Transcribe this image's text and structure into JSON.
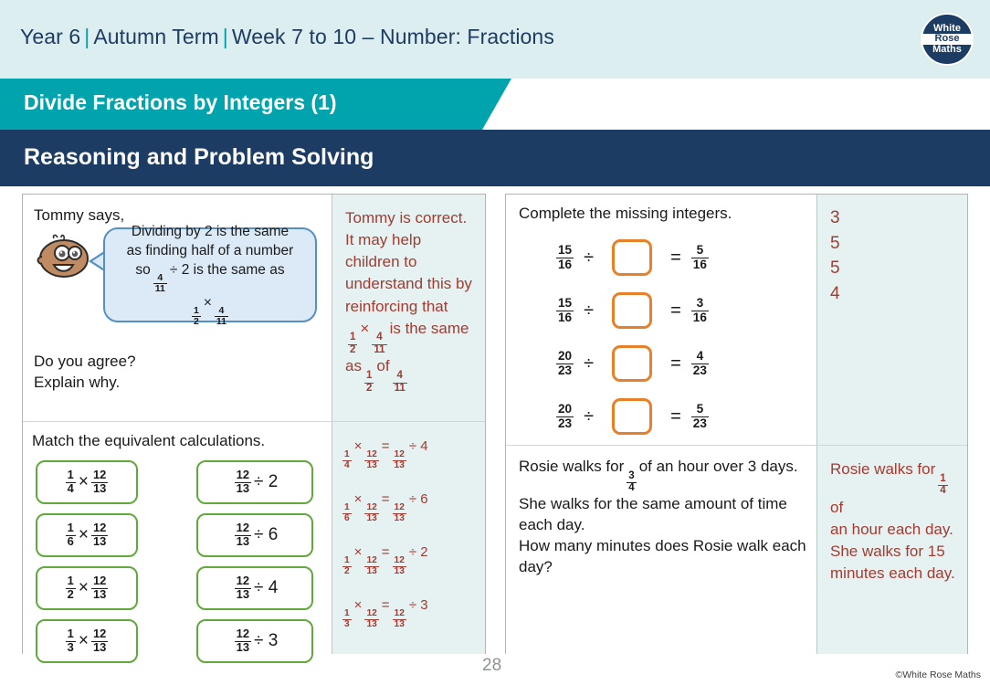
{
  "header": {
    "year": "Year 6",
    "term": "Autumn Term",
    "week": "Week 7 to 10 – Number: Fractions",
    "separator": "|",
    "logo": {
      "line1": "White",
      "line2": "Rose",
      "line3": "Maths"
    }
  },
  "banners": {
    "topic": "Divide Fractions by Integers (1)",
    "section": "Reasoning and Problem Solving"
  },
  "colors": {
    "header_band": "#ddeef0",
    "teal": "#01a3ad",
    "navy": "#1d3c63",
    "answer_bg": "#e6f2f1",
    "answer_text": "#a03c32",
    "green_card_border": "#63a83c",
    "orange_box_border": "#e8802a",
    "bubble_fill": "#dceaf7",
    "bubble_border": "#5490c4"
  },
  "q1": {
    "intro": "Tommy says,",
    "bubble_line1": "Dividing by 2 is the same",
    "bubble_line2": "as finding half of a number",
    "bubble_line3_pre": "so",
    "bubble_frac1_n": "4",
    "bubble_frac1_d": "11",
    "bubble_line3_post": "÷ 2 is the same as",
    "bubble_frac2_n": "1",
    "bubble_frac2_d": "2",
    "bubble_times": "×",
    "bubble_frac3_n": "4",
    "bubble_frac3_d": "11",
    "prompt_line1": "Do you agree?",
    "prompt_line2": "Explain why.",
    "answer_line1": "Tommy is correct.",
    "answer_line2": "It may help",
    "answer_line3": "children to",
    "answer_line4": "understand this by",
    "answer_line5": "reinforcing that",
    "answer_f1_n": "1",
    "answer_f1_d": "2",
    "answer_times": "×",
    "answer_f2_n": "4",
    "answer_f2_d": "11",
    "answer_line6": "is the same",
    "answer_line7_pre": "as",
    "answer_f3_n": "1",
    "answer_f3_d": "2",
    "answer_of": "of",
    "answer_f4_n": "4",
    "answer_f4_d": "11"
  },
  "q2": {
    "title": "Match the equivalent calculations.",
    "left_cards": [
      {
        "num": "1",
        "den": "4",
        "op": "×",
        "fnum": "12",
        "fden": "13"
      },
      {
        "num": "1",
        "den": "6",
        "op": "×",
        "fnum": "12",
        "fden": "13"
      },
      {
        "num": "1",
        "den": "2",
        "op": "×",
        "fnum": "12",
        "fden": "13"
      },
      {
        "num": "1",
        "den": "3",
        "op": "×",
        "fnum": "12",
        "fden": "13"
      }
    ],
    "right_cards": [
      {
        "num": "12",
        "den": "13",
        "op": "÷",
        "int": "2"
      },
      {
        "num": "12",
        "den": "13",
        "op": "÷",
        "int": "6"
      },
      {
        "num": "12",
        "den": "13",
        "op": "÷",
        "int": "4"
      },
      {
        "num": "12",
        "den": "13",
        "op": "÷",
        "int": "3"
      }
    ],
    "answers": [
      {
        "an": "1",
        "ad": "4",
        "bn": "12",
        "bd": "13",
        "cn": "12",
        "cd": "13",
        "int": "4"
      },
      {
        "an": "1",
        "ad": "6",
        "bn": "12",
        "bd": "13",
        "cn": "12",
        "cd": "13",
        "int": "6"
      },
      {
        "an": "1",
        "ad": "2",
        "bn": "12",
        "bd": "13",
        "cn": "12",
        "cd": "13",
        "int": "2"
      },
      {
        "an": "1",
        "ad": "3",
        "bn": "12",
        "bd": "13",
        "cn": "12",
        "cd": "13",
        "int": "3"
      }
    ]
  },
  "q3": {
    "title": "Complete the missing integers.",
    "rows": [
      {
        "ln": "15",
        "ld": "16",
        "op": "÷",
        "eq": "=",
        "rn": "5",
        "rd": "16"
      },
      {
        "ln": "15",
        "ld": "16",
        "op": "÷",
        "eq": "=",
        "rn": "3",
        "rd": "16"
      },
      {
        "ln": "20",
        "ld": "23",
        "op": "÷",
        "eq": "=",
        "rn": "4",
        "rd": "23"
      },
      {
        "ln": "20",
        "ld": "23",
        "op": "÷",
        "eq": "=",
        "rn": "5",
        "rd": "23"
      }
    ],
    "answers": [
      "3",
      "5",
      "5",
      "4"
    ]
  },
  "q4": {
    "line1_pre": "Rosie walks for",
    "frac_n": "3",
    "frac_d": "4",
    "line1_post": "of an hour over 3 days.",
    "line2": "She walks for the same amount of time",
    "line3": "each day.",
    "line4": "How many minutes does Rosie walk each",
    "line5": "day?",
    "answer_pre": "Rosie walks for",
    "answer_frac_n": "1",
    "answer_frac_d": "4",
    "answer_post": "of",
    "answer_line2": "an hour each day.",
    "answer_line3": "She walks for 15",
    "answer_line4": "minutes each day."
  },
  "footer": {
    "page_number": "28",
    "copyright": "©White Rose Maths"
  }
}
